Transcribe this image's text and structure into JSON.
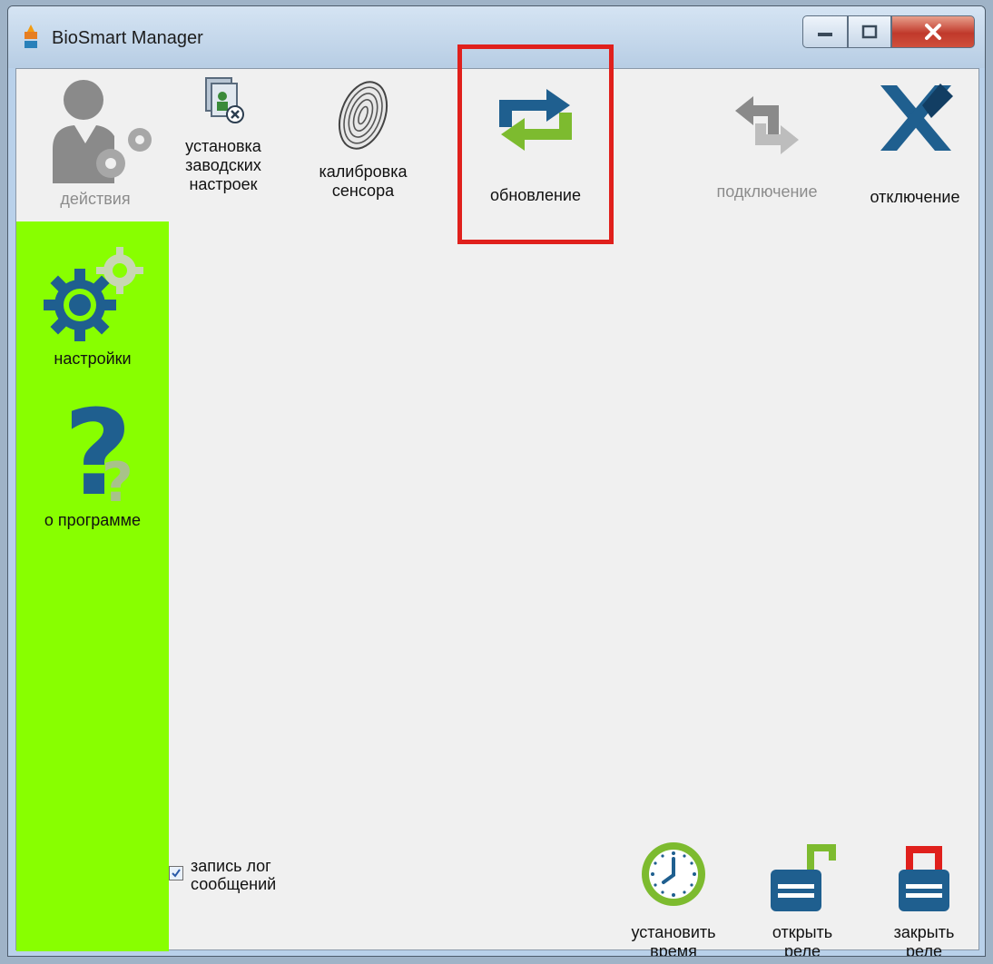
{
  "window": {
    "title": "BioSmart Manager",
    "controls": {
      "minimize": "minimize",
      "maximize": "maximize",
      "close": "close"
    }
  },
  "toolbar": {
    "actions": {
      "label": "действия",
      "icon": "person-gears-icon"
    },
    "factory_reset": {
      "label": "установка\nзаводских\nнастроек",
      "icon": "factory-reset-icon"
    },
    "calibrate": {
      "label": "калибровка\nсенсора",
      "icon": "fingerprint-icon"
    },
    "update": {
      "label": "обновление",
      "icon": "refresh-arrows-icon",
      "highlighted": true
    },
    "connect": {
      "label": "подключение",
      "icon": "connect-arrows-icon",
      "enabled": false
    },
    "disconnect": {
      "label": "отключение",
      "icon": "disconnect-x-icon"
    }
  },
  "sidebar": {
    "items": [
      {
        "label": "настройки",
        "icon": "settings-gears-icon"
      },
      {
        "label": "о программе",
        "icon": "question-icon"
      }
    ]
  },
  "log": {
    "label": "запись лог\nсообщений",
    "checked": true
  },
  "bottom_actions": [
    {
      "label": "установить\nвремя",
      "icon": "clock-icon"
    },
    {
      "label": "открыть\nреле",
      "icon": "open-lock-icon"
    },
    {
      "label": "закрыть\nреле",
      "icon": "closed-lock-icon"
    }
  ],
  "colors": {
    "sidebar": "#88ff00",
    "highlight": "#e0201c",
    "blue": "#1f5f8f",
    "green": "#7dbb2f",
    "gray": "#8c8c8c",
    "red": "#e0201c"
  }
}
